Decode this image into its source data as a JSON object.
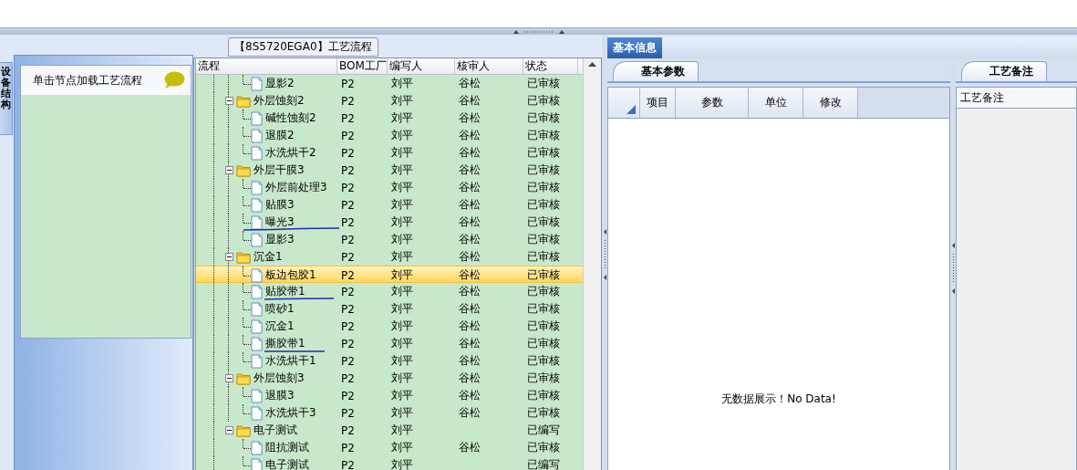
{
  "left_panel": {
    "vertical_tab": "设备结构",
    "hint": "单击节点加载工艺流程"
  },
  "process_panel": {
    "title": "【8S5720EGA0】工艺流程",
    "columns": [
      "流程",
      "BOM工厂",
      "编写人",
      "核审人",
      "状态"
    ],
    "tree": [
      {
        "children": [
          {
            "name": "显影2",
            "bom": "P2",
            "author": "刘平",
            "reviewer": "谷松",
            "status": "已审核",
            "selected": false
          }
        ]
      },
      {
        "name": "外层蚀刻2",
        "bom": "P2",
        "author": "刘平",
        "reviewer": "谷松",
        "status": "已审核",
        "selected": false,
        "expanded": true,
        "children": [
          {
            "name": "碱性蚀刻2",
            "bom": "P2",
            "author": "刘平",
            "reviewer": "谷松",
            "status": "已审核",
            "selected": false
          },
          {
            "name": "退膜2",
            "bom": "P2",
            "author": "刘平",
            "reviewer": "谷松",
            "status": "已审核",
            "selected": false
          },
          {
            "name": "水洗烘干2",
            "bom": "P2",
            "author": "刘平",
            "reviewer": "谷松",
            "status": "已审核",
            "selected": false
          }
        ]
      },
      {
        "name": "外层干膜3",
        "bom": "P2",
        "author": "刘平",
        "reviewer": "谷松",
        "status": "已审核",
        "selected": false,
        "expanded": true,
        "children": [
          {
            "name": "外层前处理3",
            "bom": "P2",
            "author": "刘平",
            "reviewer": "谷松",
            "status": "已审核",
            "selected": false
          },
          {
            "name": "贴膜3",
            "bom": "P2",
            "author": "刘平",
            "reviewer": "谷松",
            "status": "已审核",
            "selected": false
          },
          {
            "name": "曝光3",
            "bom": "P2",
            "author": "刘平",
            "reviewer": "谷松",
            "status": "已审核",
            "selected": false
          },
          {
            "name": "显影3",
            "bom": "P2",
            "author": "刘平",
            "reviewer": "谷松",
            "status": "已审核",
            "selected": false
          }
        ]
      },
      {
        "name": "沉金1",
        "bom": "P2",
        "author": "刘平",
        "reviewer": "谷松",
        "status": "已审核",
        "selected": false,
        "expanded": true,
        "children": [
          {
            "name": "板边包胶1",
            "bom": "P2",
            "author": "刘平",
            "reviewer": "谷松",
            "status": "已审核",
            "selected": true
          },
          {
            "name": "贴胶带1",
            "bom": "P2",
            "author": "刘平",
            "reviewer": "谷松",
            "status": "已审核",
            "selected": false
          },
          {
            "name": "喷砂1",
            "bom": "P2",
            "author": "刘平",
            "reviewer": "谷松",
            "status": "已审核",
            "selected": false
          },
          {
            "name": "沉金1",
            "bom": "P2",
            "author": "刘平",
            "reviewer": "谷松",
            "status": "已审核",
            "selected": false
          },
          {
            "name": "撕胶带1",
            "bom": "P2",
            "author": "刘平",
            "reviewer": "谷松",
            "status": "已审核",
            "selected": false
          },
          {
            "name": "水洗烘干1",
            "bom": "P2",
            "author": "刘平",
            "reviewer": "谷松",
            "status": "已审核",
            "selected": false
          }
        ]
      },
      {
        "name": "外层蚀刻3",
        "bom": "P2",
        "author": "刘平",
        "reviewer": "谷松",
        "status": "已审核",
        "selected": false,
        "expanded": true,
        "children": [
          {
            "name": "退膜3",
            "bom": "P2",
            "author": "刘平",
            "reviewer": "谷松",
            "status": "已审核",
            "selected": false
          },
          {
            "name": "水洗烘干3",
            "bom": "P2",
            "author": "刘平",
            "reviewer": "谷松",
            "status": "已审核",
            "selected": false
          }
        ]
      },
      {
        "name": "电子测试",
        "bom": "P2",
        "author": "刘平",
        "status": "已编写",
        "selected": false,
        "expanded": true,
        "children": [
          {
            "name": "阻抗测试",
            "bom": "P2",
            "author": "刘平",
            "reviewer": "谷松",
            "status": "已审核",
            "selected": false
          },
          {
            "name": "电子测试",
            "bom": "P2",
            "author": "刘平",
            "status": "已编写",
            "selected": false
          }
        ]
      }
    ]
  },
  "info_tabs": [
    {
      "label": "基本信息",
      "selected": true
    }
  ],
  "params_panel": {
    "tabs": [
      {
        "label": "基本参数",
        "selected": true
      }
    ],
    "columns": [
      "项目",
      "参数",
      "单位",
      "修改"
    ],
    "empty_text": "无数据展示！No Data!"
  },
  "notes_panel": {
    "tabs": [
      {
        "label": "工艺备注",
        "selected": true
      }
    ],
    "header": "工艺备注"
  }
}
